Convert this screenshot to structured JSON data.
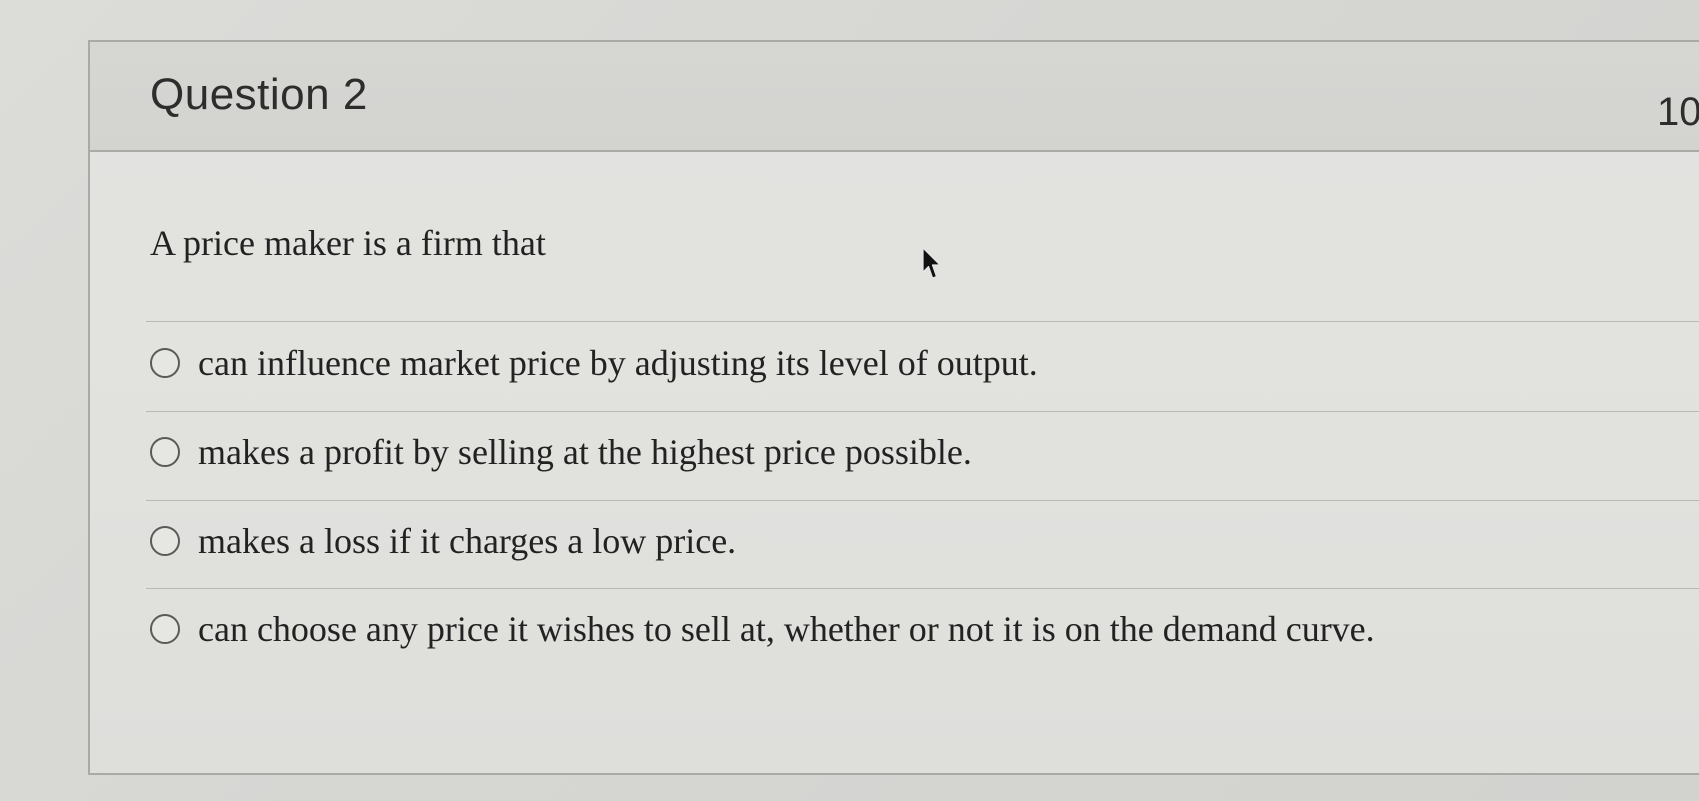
{
  "question": {
    "title": "Question 2",
    "points": "10",
    "text": "A price maker is a firm that"
  },
  "options": [
    {
      "label": "can influence market price by adjusting its level of output."
    },
    {
      "label": "makes a profit by selling at the highest price possible."
    },
    {
      "label": "makes a loss if it charges a low price."
    },
    {
      "label": "can choose any price it wishes to sell at, whether or not it is on the demand curve."
    }
  ],
  "icons": {
    "cursor": "mouse-pointer-icon",
    "radio": "radio-unselected-icon"
  }
}
